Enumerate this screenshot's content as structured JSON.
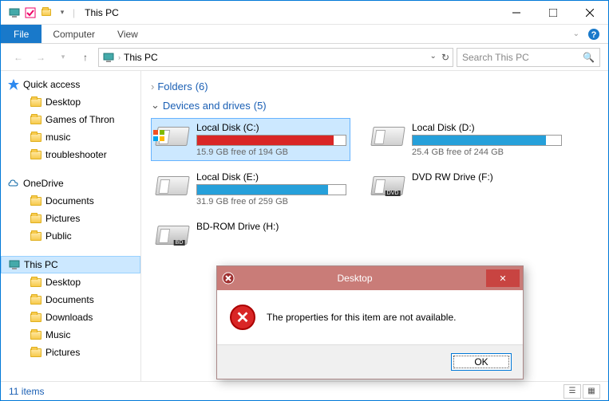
{
  "window": {
    "title": "This PC"
  },
  "ribbon": {
    "file": "File",
    "tabs": [
      "Computer",
      "View"
    ]
  },
  "nav": {
    "crumb": "This PC",
    "search_placeholder": "Search This PC"
  },
  "sidebar": {
    "quick_access": {
      "label": "Quick access",
      "items": [
        "Desktop",
        "Games of Thron",
        "music",
        "troubleshooter"
      ]
    },
    "onedrive": {
      "label": "OneDrive",
      "items": [
        "Documents",
        "Pictures",
        "Public"
      ]
    },
    "this_pc": {
      "label": "This PC",
      "items": [
        "Desktop",
        "Documents",
        "Downloads",
        "Music",
        "Pictures"
      ]
    }
  },
  "content": {
    "folders_header": "Folders",
    "folders_count": "(6)",
    "drives_header": "Devices and drives",
    "drives_count": "(5)",
    "drives": [
      {
        "name": "Local Disk (C:)",
        "free": "15.9 GB free of 194 GB",
        "fill_pct": 92,
        "color": "red",
        "selected": true,
        "type": "hdd-win"
      },
      {
        "name": "Local Disk (D:)",
        "free": "25.4 GB free of 244 GB",
        "fill_pct": 90,
        "color": "blue",
        "selected": false,
        "type": "hdd"
      },
      {
        "name": "Local Disk (E:)",
        "free": "31.9 GB free of 259 GB",
        "fill_pct": 88,
        "color": "blue",
        "selected": false,
        "type": "hdd"
      },
      {
        "name": "DVD RW Drive (F:)",
        "free": "",
        "fill_pct": 0,
        "color": "",
        "selected": false,
        "type": "dvd"
      },
      {
        "name": "BD-ROM Drive (H:)",
        "free": "",
        "fill_pct": 0,
        "color": "",
        "selected": false,
        "type": "bd"
      }
    ]
  },
  "statusbar": {
    "items": "11 items"
  },
  "dialog": {
    "title": "Desktop",
    "message": "The properties for this item are not available.",
    "ok": "OK"
  }
}
